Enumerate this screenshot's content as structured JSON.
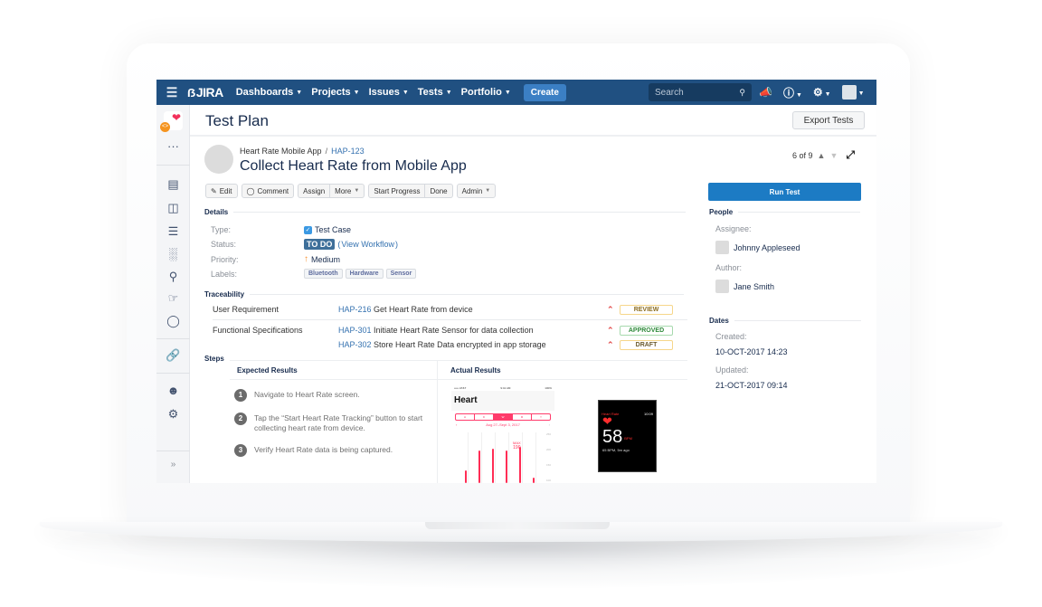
{
  "topnav": {
    "logo": "JIRA",
    "menu": [
      {
        "label": "Dashboards"
      },
      {
        "label": "Projects"
      },
      {
        "label": "Issues"
      },
      {
        "label": "Tests"
      },
      {
        "label": "Portfolio"
      }
    ],
    "create_label": "Create",
    "search_placeholder": "Search"
  },
  "sidebar": {
    "items": [
      "more-icon",
      "board-icon",
      "columns-icon",
      "backlog-icon",
      "reports-icon",
      "test-search-icon",
      "components-icon",
      "releases-icon",
      "link-icon",
      "add-user-icon",
      "settings-icon",
      "expand-icon"
    ]
  },
  "header": {
    "title": "Test Plan",
    "export_label": "Export Tests"
  },
  "issue": {
    "project": "Heart Rate Mobile App",
    "key": "HAP-123",
    "title": "Collect Heart Rate from Mobile App",
    "pager": "6 of 9"
  },
  "toolbar": {
    "edit": "Edit",
    "comment": "Comment",
    "assign": "Assign",
    "more": "More",
    "start_progress": "Start Progress",
    "done": "Done",
    "admin": "Admin",
    "run_test": "Run Test"
  },
  "details": {
    "heading": "Details",
    "type_label": "Type:",
    "type_value": "Test Case",
    "status_label": "Status:",
    "status_value": "TO DO",
    "workflow_open": "(",
    "workflow_link": "View Workflow",
    "workflow_close": ")",
    "priority_label": "Priority:",
    "priority_value": "Medium",
    "labels_label": "Labels:",
    "labels": [
      "Bluetooth",
      "Hardware",
      "Sensor"
    ]
  },
  "traceability": {
    "heading": "Traceability",
    "rows": [
      {
        "group": "User Requirement",
        "key": "HAP-216",
        "summary": "Get Heart Rate from device",
        "status": "REVIEW"
      },
      {
        "group": "Functional Specifications",
        "key": "HAP-301",
        "summary": "Initiate Heart Rate Sensor for data collection",
        "status": "APPROVED"
      },
      {
        "group": "",
        "key": "HAP-302",
        "summary": "Store Heart Rate Data encrypted in app storage",
        "status": "DRAFT"
      }
    ]
  },
  "steps": {
    "heading": "Steps",
    "expected_header": "Expected Results",
    "actual_header": "Actual Results",
    "items": [
      {
        "num": "1",
        "text": "Navigate to Heart Rate screen."
      },
      {
        "num": "2",
        "text": "Tap the “Start Heart Rate Tracking” button to start collecting heart rate from device."
      },
      {
        "num": "3",
        "text": "Verify Heart Rate data is being captured."
      }
    ]
  },
  "phone": {
    "carrier": "••••• AT&T",
    "time": "9:41 AM",
    "battery": "100%",
    "title": "Heart",
    "segments": [
      "H",
      "D",
      "W",
      "M",
      "Y"
    ],
    "active_segment": "W",
    "range": "Aug 27–Sept 3, 2017",
    "max_label": "MAX",
    "max_value": "190",
    "y_ticks": [
      "250",
      "200",
      "150",
      "100"
    ]
  },
  "watch": {
    "title": "Heart Rate",
    "time": "10:09",
    "bpm": "58",
    "unit": "BPM",
    "sub": "65 BPM, 5m ago"
  },
  "people": {
    "heading": "People",
    "assignee_label": "Assignee:",
    "assignee": "Johnny Appleseed",
    "author_label": "Author:",
    "author": "Jane Smith"
  },
  "dates": {
    "heading": "Dates",
    "created_label": "Created:",
    "created": "10-OCT-2017 14:23",
    "updated_label": "Updated:",
    "updated": "21-OCT-2017 09:14"
  },
  "colors": {
    "nav": "#205081",
    "accent": "#1c7bc4",
    "link": "#3572b0",
    "heart": "#ff2d55"
  }
}
